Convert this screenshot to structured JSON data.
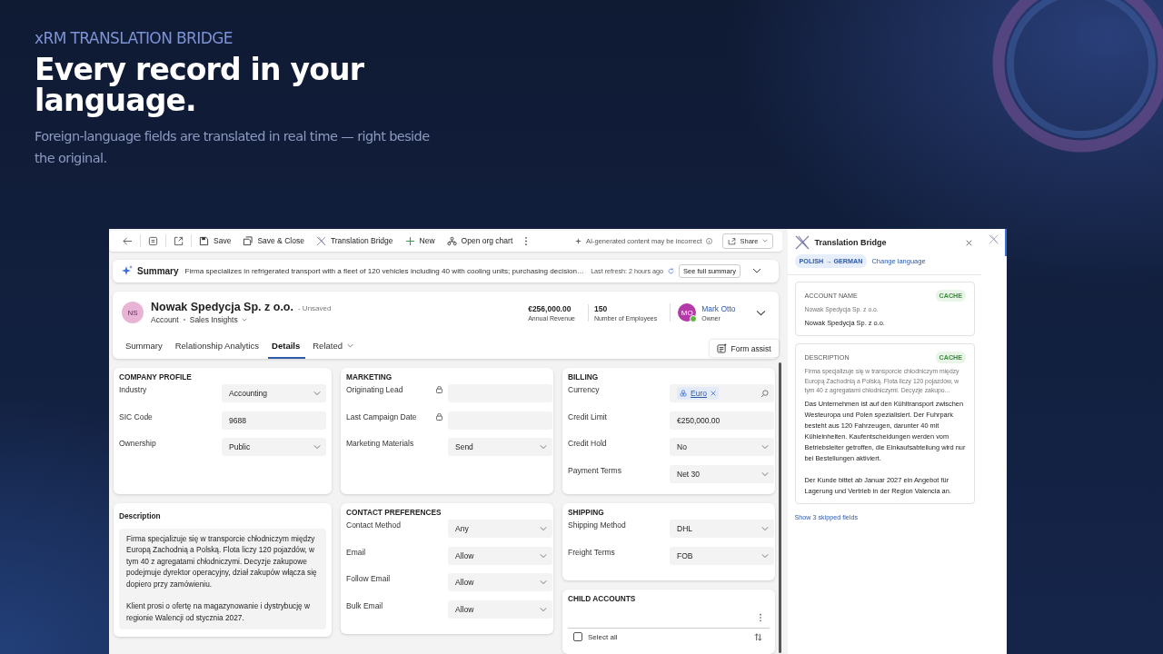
{
  "hero": {
    "eyebrow": "xRM TRANSLATION BRIDGE",
    "title": "Every record in your language.",
    "subtitle": "Foreign-language fields are translated in real time — right beside the original."
  },
  "toolbar": {
    "actions": [
      {
        "kind": "save",
        "label": "Save"
      },
      {
        "kind": "save_close",
        "label": "Save & Close"
      },
      {
        "kind": "translate",
        "label": "Translation Bridge"
      },
      {
        "kind": "new",
        "label": "New"
      },
      {
        "kind": "org_chart",
        "label": "Open org chart"
      }
    ],
    "ai_notice": "AI-generated content may be incorrect",
    "share": "Share"
  },
  "summary": {
    "title": "Summary",
    "text": "Firma specializes in refrigerated transport with a fleet of 120 vehicles including 40 with cooling units; purchasing decision…",
    "refresh": "Last refresh: 2 hours ago",
    "button": "See full summary"
  },
  "record": {
    "initials": "NS",
    "name": "Nowak Spedycja Sp. z o.o.",
    "status": "- Unsaved",
    "entity": "Account",
    "view": "Sales Insights",
    "stats": [
      {
        "value": "€256,000.00",
        "label": "Annual Revenue"
      },
      {
        "value": "150",
        "label": "Number of Employees"
      }
    ],
    "owner": {
      "initials": "MO",
      "name": "Mark Otto",
      "role": "Owner"
    }
  },
  "tabs": [
    {
      "label": "Summary",
      "selected": false,
      "has_menu": false
    },
    {
      "label": "Relationship Analytics",
      "selected": false,
      "has_menu": false
    },
    {
      "label": "Details",
      "selected": true,
      "has_menu": false
    },
    {
      "label": "Related",
      "selected": false,
      "has_menu": true
    }
  ],
  "form_assist": "Form assist",
  "columns": [
    {
      "sections": [
        {
          "kind": "fields",
          "title": "COMPANY PROFILE",
          "fields": [
            {
              "label": "Industry",
              "kind": "select",
              "value": "Accounting"
            },
            {
              "label": "SIC Code",
              "kind": "text",
              "value": "9688"
            },
            {
              "label": "Ownership",
              "kind": "select",
              "value": "Public"
            }
          ]
        },
        {
          "kind": "description",
          "title": "Description",
          "text": "Firma specjalizuje się w transporcie chłodniczym między Europą Zachodnią a Polską. Flota liczy 120 pojazdów, w tym 40 z agregatami chłodniczymi. Decyzje zakupowe podejmuje dyrektor operacyjny, dział zakupów włącza się dopiero przy zamówieniu.\n\nKlient prosi o ofertę na magazynowanie i dystrybucję w regionie Walencji od stycznia 2027."
        }
      ]
    },
    {
      "sections": [
        {
          "kind": "fields",
          "title": "MARKETING",
          "fields": [
            {
              "label": "Originating Lead",
              "kind": "locked"
            },
            {
              "label": "Last Campaign Date",
              "kind": "locked"
            },
            {
              "label": "Marketing Materials",
              "kind": "select",
              "value": "Send"
            }
          ]
        },
        {
          "kind": "fields",
          "title": "CONTACT PREFERENCES",
          "fields": [
            {
              "label": "Contact Method",
              "kind": "select",
              "value": "Any"
            },
            {
              "label": "Email",
              "kind": "select",
              "value": "Allow"
            },
            {
              "label": "Follow Email",
              "kind": "select",
              "value": "Allow"
            },
            {
              "label": "Bulk Email",
              "kind": "select",
              "value": "Allow"
            }
          ]
        }
      ]
    },
    {
      "sections": [
        {
          "kind": "fields",
          "title": "BILLING",
          "fields": [
            {
              "label": "Currency",
              "kind": "lookup",
              "value": "Euro"
            },
            {
              "label": "Credit Limit",
              "kind": "text",
              "value": "€250,000.00"
            },
            {
              "label": "Credit Hold",
              "kind": "select",
              "value": "No"
            },
            {
              "label": "Payment Terms",
              "kind": "select",
              "value": "Net 30"
            }
          ]
        },
        {
          "kind": "fields",
          "title": "SHIPPING",
          "fields": [
            {
              "label": "Shipping Method",
              "kind": "select",
              "value": "DHL"
            },
            {
              "label": "Freight Terms",
              "kind": "select",
              "value": "FOB"
            }
          ]
        },
        {
          "kind": "grid",
          "title": "CHILD ACCOUNTS",
          "select_all": "Select all",
          "select_all_checked": false
        }
      ]
    }
  ],
  "panel": {
    "title": "Translation Bridge",
    "language_pair": "POLISH → GERMAN",
    "change_language": "Change language",
    "cards": [
      {
        "label": "ACCOUNT NAME",
        "badge": "CACHE",
        "original": "Nowak Spedycja Sp. z o.o.",
        "translation": "Nowak Spedycja Sp. z o.o."
      },
      {
        "label": "DESCRIPTION",
        "badge": "CACHE",
        "original": "Firma specjalizuje się w transporcie chłodniczym między Europą Zachodnią a Polską. Flota liczy 120 pojazdów, w tym 40 z agregatami chłodniczymi. Decyzje zakupo...",
        "translation": "Das Unternehmen ist auf den Kühltransport zwischen Westeuropa und Polen spezialisiert. Der Fuhrpark besteht aus 120 Fahrzeugen, darunter 40 mit Kühleinheiten. Kaufentscheidungen werden vom Betriebsleiter getroffen, die Einkaufsabteilung wird nur bei Bestellungen aktiviert.\n\nDer Kunde bittet ab Januar 2027 ein Angebot für Lagerung und Vertrieb in der Region Valencia an."
      }
    ],
    "skipped": "Show 3 skipped fields"
  }
}
